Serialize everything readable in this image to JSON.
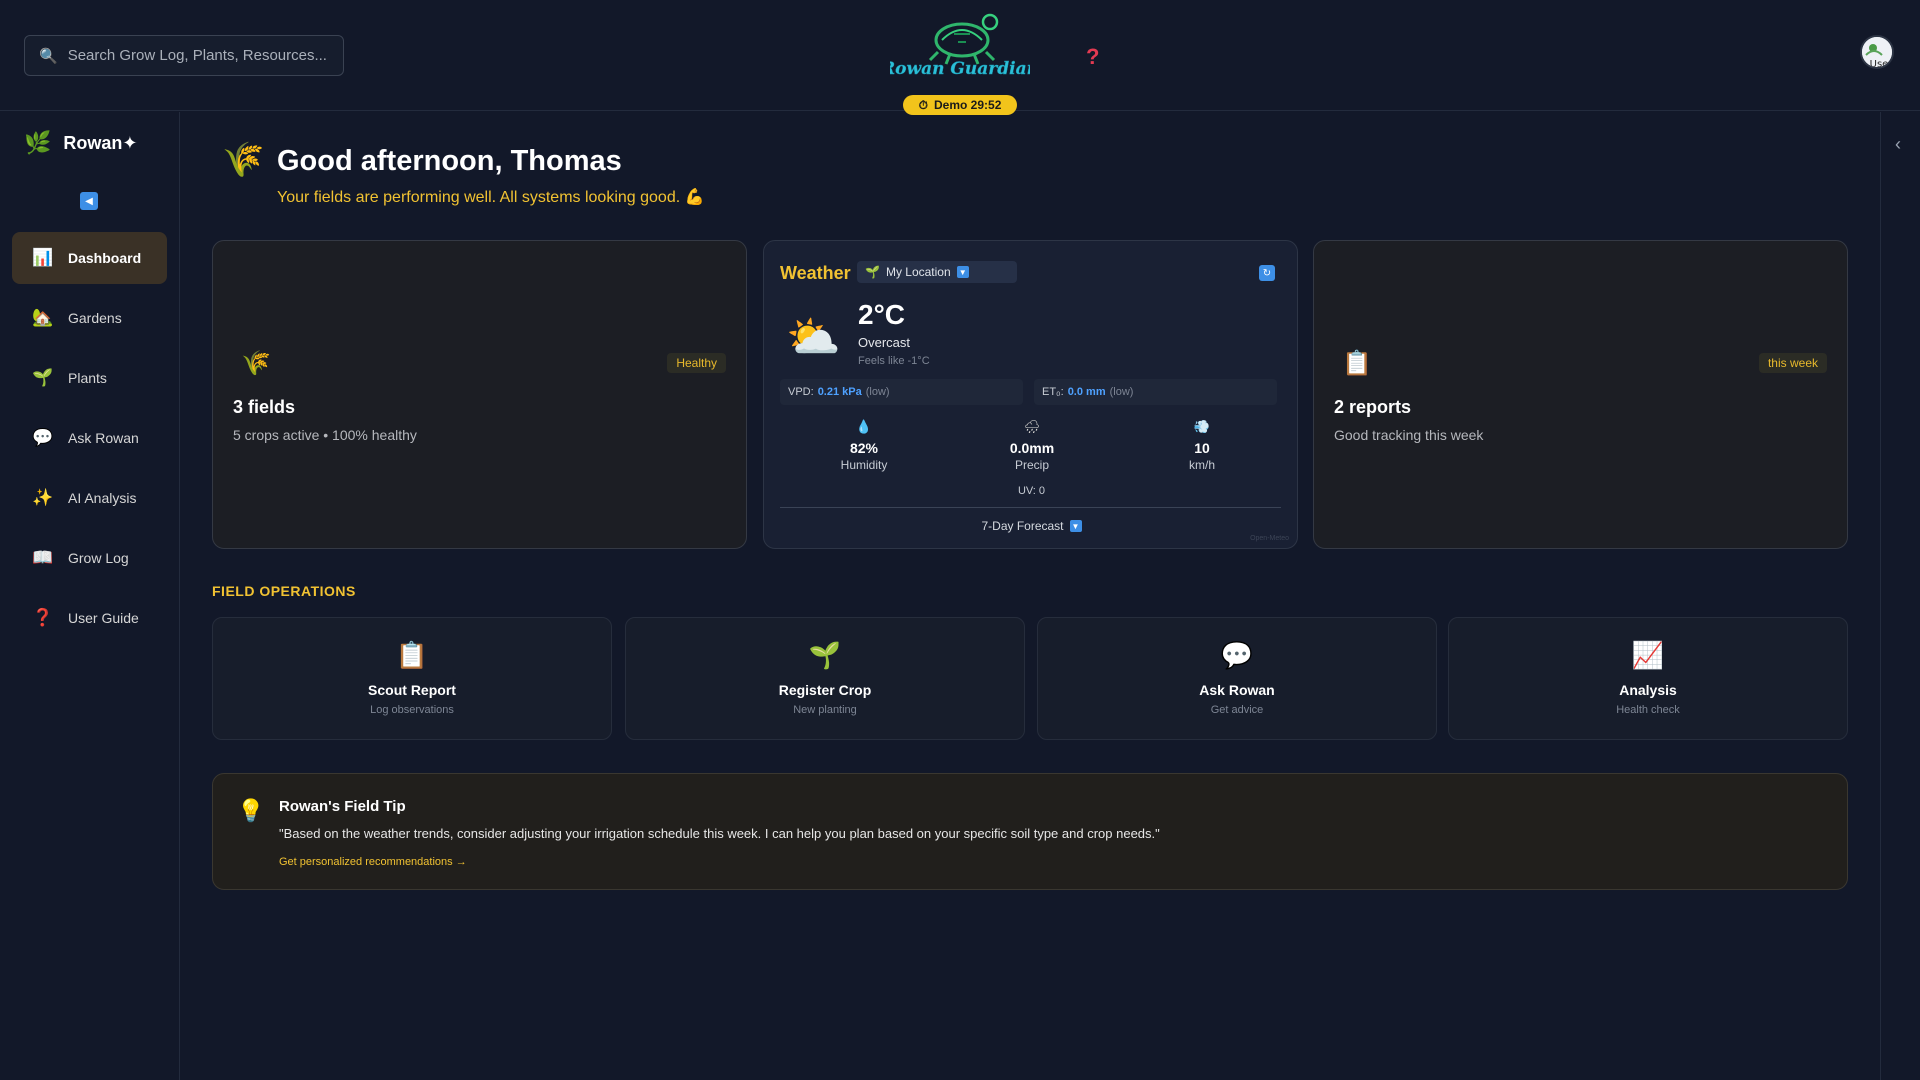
{
  "header": {
    "search_placeholder": "Search Grow Log, Plants, Resources...",
    "logo_text": "Rowan Guardian",
    "help_glyph": "?",
    "demo_timer": "Demo 29:52",
    "avatar_label": "Use"
  },
  "sidebar": {
    "brand": "Rowan✦",
    "items": [
      {
        "label": "Dashboard",
        "icon": "bar-chart-icon",
        "glyph": "📊",
        "active": true
      },
      {
        "label": "Gardens",
        "icon": "barn-icon",
        "glyph": "🏡",
        "active": false
      },
      {
        "label": "Plants",
        "icon": "seedling-icon",
        "glyph": "🌱",
        "active": false
      },
      {
        "label": "Ask Rowan",
        "icon": "speech-bubble-icon",
        "glyph": "💬",
        "active": false
      },
      {
        "label": "AI Analysis",
        "icon": "sparkles-icon",
        "glyph": "✨",
        "active": false
      },
      {
        "label": "Grow Log",
        "icon": "book-icon",
        "glyph": "📖",
        "active": false
      },
      {
        "label": "User Guide",
        "icon": "question-icon",
        "glyph": "❓",
        "active": false
      }
    ]
  },
  "greeting": {
    "title": "Good afternoon, Thomas",
    "subtitle": "Your fields are performing well. All systems looking good. 💪"
  },
  "fields_card": {
    "badge": "Healthy",
    "title": "3 fields",
    "subtitle": "5 crops active • 100% healthy"
  },
  "weather": {
    "title": "Weather",
    "location": "My Location",
    "temperature": "2°C",
    "condition": "Overcast",
    "feels_like": "Feels like -1°C",
    "vpd_label": "VPD:",
    "vpd_value": "0.21 kPa",
    "vpd_level": "(low)",
    "et_label": "ET₀:",
    "et_value": "0.0 mm",
    "et_level": "(low)",
    "humidity_value": "82%",
    "humidity_label": "Humidity",
    "precip_value": "0.0mm",
    "precip_label": "Precip",
    "wind_value": "10",
    "wind_label": "km/h",
    "uv": "UV: 0",
    "forecast_label": "7-Day Forecast",
    "credit": "Open-Meteo"
  },
  "reports_card": {
    "badge": "this week",
    "title": "2 reports",
    "subtitle": "Good tracking this week"
  },
  "operations": {
    "heading": "FIELD OPERATIONS",
    "items": [
      {
        "label": "Scout Report",
        "sub": "Log observations",
        "icon": "clipboard-icon"
      },
      {
        "label": "Register Crop",
        "sub": "New planting",
        "icon": "seedling-icon"
      },
      {
        "label": "Ask Rowan",
        "sub": "Get advice",
        "icon": "speech-bubble-icon"
      },
      {
        "label": "Analysis",
        "sub": "Health check",
        "icon": "chart-up-icon"
      }
    ]
  },
  "tip": {
    "title": "Rowan's Field Tip",
    "quote": "\"Based on the weather trends, consider adjusting your irrigation schedule this week. I can help you plan based on your specific soil type and crop needs.\"",
    "link": "Get personalized recommendations →"
  },
  "colors": {
    "background": "#121829",
    "accent_yellow": "#f1c232",
    "accent_blue": "#3d8fe6",
    "active_nav": "#3a3126"
  }
}
